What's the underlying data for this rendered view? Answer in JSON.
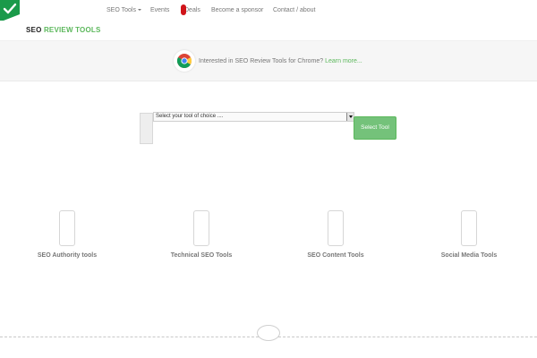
{
  "brand": {
    "part1": "SEO",
    "part2": "REVIEW TOOLS"
  },
  "nav": {
    "seo_tools": "SEO Tools",
    "events": "Events",
    "deals": "Deals",
    "sponsor": "Become a sponsor",
    "contact": "Contact / about"
  },
  "banner": {
    "text": "Interested in SEO Review Tools for Chrome?",
    "link": "Learn more..."
  },
  "tool_select": {
    "selected": "Select your tool of choice ....",
    "button": "Select Tool"
  },
  "categories": [
    {
      "label": "SEO Authority tools"
    },
    {
      "label": "Technical SEO Tools"
    },
    {
      "label": "SEO Content Tools"
    },
    {
      "label": "Social Media Tools"
    }
  ],
  "colors": {
    "accent": "#5cb85c",
    "deals_badge": "#d0141a",
    "banner_bg": "#f6f6f6"
  },
  "icons": {
    "logo": "checkmark-badge-icon",
    "chrome": "chrome-icon",
    "category": "device-outline-icon"
  }
}
